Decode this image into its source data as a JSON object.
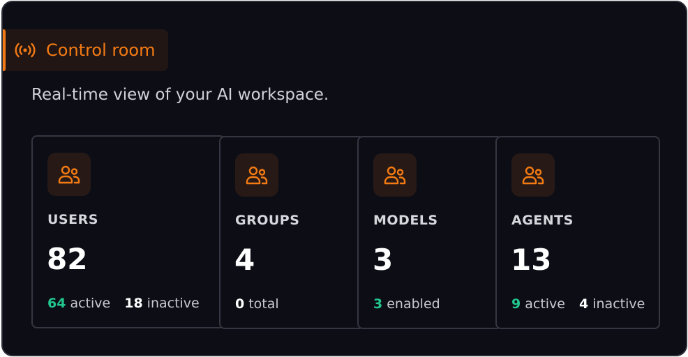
{
  "header": {
    "title": "Control room",
    "icon": "broadcast-icon",
    "subtitle": "Real-time view of your AI workspace."
  },
  "colors": {
    "accent": "#f47b13",
    "positive": "#22c58d",
    "panel_bg": "#0c0d15",
    "card_border": "#343641"
  },
  "cards": [
    {
      "label": "USERS",
      "value": "82",
      "icon": "users-icon",
      "stats": [
        {
          "num": "64",
          "text": "active",
          "tone": "green"
        },
        {
          "num": "18",
          "text": "inactive",
          "tone": "white"
        }
      ]
    },
    {
      "label": "GROUPS",
      "value": "4",
      "icon": "users-icon",
      "stats": [
        {
          "num": "0",
          "text": "total",
          "tone": "white"
        }
      ]
    },
    {
      "label": "MODELS",
      "value": "3",
      "icon": "users-icon",
      "stats": [
        {
          "num": "3",
          "text": "enabled",
          "tone": "green"
        }
      ]
    },
    {
      "label": "AGENTS",
      "value": "13",
      "icon": "users-icon",
      "stats": [
        {
          "num": "9",
          "text": "active",
          "tone": "green"
        },
        {
          "num": "4",
          "text": "inactive",
          "tone": "white"
        }
      ]
    }
  ]
}
